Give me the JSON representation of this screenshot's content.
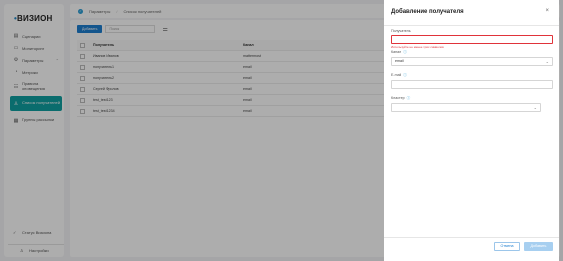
{
  "app": {
    "logo_prefix": "•",
    "logo_text": "ВИЗИОН"
  },
  "sidebar": {
    "items": [
      {
        "label": "Сценарии",
        "icon": "layers-icon"
      },
      {
        "label": "Мониторинг",
        "icon": "monitor-icon"
      },
      {
        "label": "Параметры",
        "icon": "settings-icon",
        "expandable": true
      },
      {
        "label": "Метрики",
        "icon": "gauge-icon"
      },
      {
        "label": "Правила оповещения",
        "icon": "rules-icon"
      },
      {
        "label": "Список получателей",
        "icon": "recipients-icon",
        "active": true
      },
      {
        "label": "Группы рассылки",
        "icon": "group-icon"
      }
    ],
    "status": "Статус Визиона",
    "settings": "Настройки"
  },
  "topbar": {
    "crumb1": "Параметры",
    "separator": "/",
    "crumb2": "Список получателей"
  },
  "toolbar": {
    "add_label": "Добавить",
    "search_placeholder": "Поиск"
  },
  "table": {
    "headers": [
      "Получатель",
      "Канал"
    ],
    "rows": [
      [
        "Иванов Иванов",
        "mattermost"
      ],
      [
        "получатель1",
        "email"
      ],
      [
        "получатель2",
        "email"
      ],
      [
        "Сергей Фролов",
        "email"
      ],
      [
        "test_test123",
        "email"
      ],
      [
        "test_test1234",
        "email"
      ]
    ]
  },
  "modal": {
    "title": "Добавление получателя",
    "recipient_label": "Получатель",
    "recipient_error": "Используйте не менее трёх символов",
    "channel_label": "Канал",
    "channel_value": "email",
    "email_label": "E-mail",
    "cluster_label": "Кластер",
    "cancel_label": "Отмена",
    "add_label": "Добавить",
    "colors": {
      "accent": "#1e7fd0",
      "error": "#e0333a",
      "active_nav": "#0f9fa1"
    }
  }
}
